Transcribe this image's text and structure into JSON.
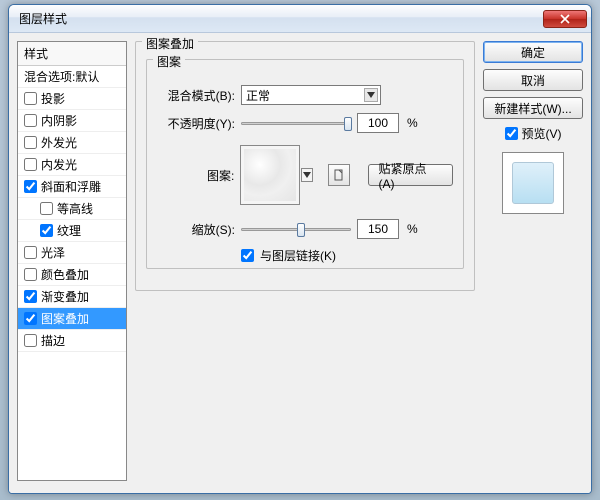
{
  "window": {
    "title": "图层样式"
  },
  "sidebar": {
    "header": "样式",
    "blending": "混合选项:默认",
    "items": [
      {
        "label": "投影",
        "checked": false,
        "indent": false
      },
      {
        "label": "内阴影",
        "checked": false,
        "indent": false
      },
      {
        "label": "外发光",
        "checked": false,
        "indent": false
      },
      {
        "label": "内发光",
        "checked": false,
        "indent": false
      },
      {
        "label": "斜面和浮雕",
        "checked": true,
        "indent": false
      },
      {
        "label": "等高线",
        "checked": false,
        "indent": true
      },
      {
        "label": "纹理",
        "checked": true,
        "indent": true
      },
      {
        "label": "光泽",
        "checked": false,
        "indent": false
      },
      {
        "label": "颜色叠加",
        "checked": false,
        "indent": false
      },
      {
        "label": "渐变叠加",
        "checked": true,
        "indent": false
      },
      {
        "label": "图案叠加",
        "checked": true,
        "indent": false,
        "selected": true
      },
      {
        "label": "描边",
        "checked": false,
        "indent": false
      }
    ]
  },
  "panel": {
    "title": "图案叠加",
    "group": "图案",
    "blend_mode_label": "混合模式(B):",
    "blend_mode_value": "正常",
    "opacity_label": "不透明度(Y):",
    "opacity_value": "100",
    "opacity_unit": "%",
    "pattern_label": "图案:",
    "snap_btn": "贴紧原点(A)",
    "scale_label": "缩放(S):",
    "scale_value": "150",
    "scale_unit": "%",
    "link_label": "与图层链接(K)",
    "link_checked": true
  },
  "buttons": {
    "ok": "确定",
    "cancel": "取消",
    "new_style": "新建样式(W)...",
    "preview": "预览(V)",
    "preview_checked": true
  }
}
